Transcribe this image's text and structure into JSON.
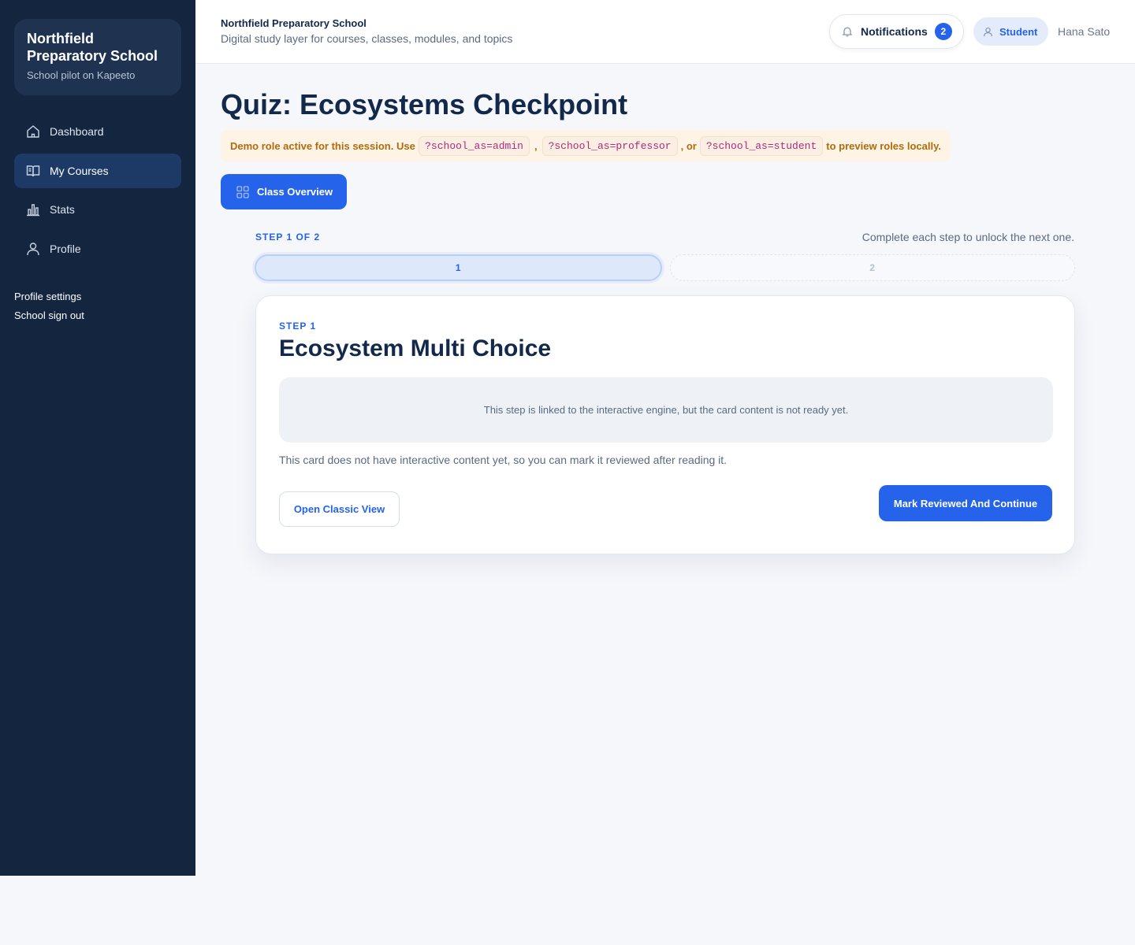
{
  "sidebar": {
    "brand_title": "Northfield Preparatory School",
    "brand_subtitle": "School pilot on Kapeeto",
    "nav": [
      {
        "label": "Dashboard",
        "icon": "home-icon"
      },
      {
        "label": "My Courses",
        "icon": "book-icon",
        "active": true
      },
      {
        "label": "Stats",
        "icon": "bar-chart-icon"
      },
      {
        "label": "Profile",
        "icon": "user-icon"
      }
    ],
    "links": [
      "Profile settings",
      "School sign out"
    ]
  },
  "header": {
    "title": "Northfield Preparatory School",
    "subtitle": "Digital study layer for courses, classes, modules, and topics",
    "notifications_label": "Notifications",
    "notifications_count": "2",
    "role": "Student",
    "user_name": "Hana Sato"
  },
  "main": {
    "page_title": "Quiz: Ecosystems Checkpoint",
    "banner": {
      "prefix": "Demo role active for this session. Use",
      "code_admin": "?school_as=admin",
      "sep1": ",",
      "code_professor": "?school_as=professor",
      "sep2": ", or",
      "code_student": "?school_as=student",
      "suffix": "to preview roles locally."
    },
    "overview_button": "Class Overview",
    "step_counter": "STEP 1 OF 2",
    "step_hint": "Complete each step to unlock the next one.",
    "steps": [
      "1",
      "2"
    ],
    "card": {
      "step_label": "STEP 1",
      "title": "Ecosystem Multi Choice",
      "engine_message": "This step is linked to the interactive engine, but the card content is not ready yet.",
      "note": "This card does not have interactive content yet, so you can mark it reviewed after reading it.",
      "classic_button": "Open Classic View",
      "continue_button": "Mark Reviewed And Continue"
    }
  },
  "colors": {
    "sidebar_bg": "#13253f",
    "accent": "#2563eb",
    "banner_bg": "#fdf4e6",
    "banner_text": "#b26a0c"
  }
}
